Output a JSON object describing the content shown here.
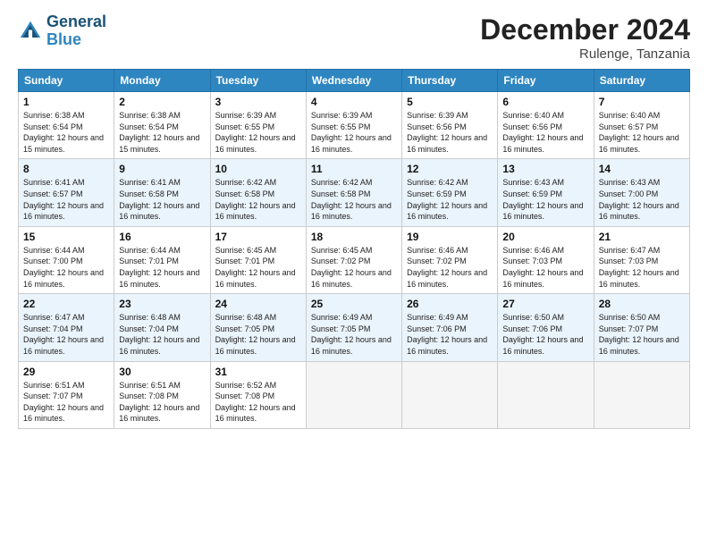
{
  "header": {
    "logo_line1": "General",
    "logo_line2": "Blue",
    "month_title": "December 2024",
    "location": "Rulenge, Tanzania"
  },
  "weekdays": [
    "Sunday",
    "Monday",
    "Tuesday",
    "Wednesday",
    "Thursday",
    "Friday",
    "Saturday"
  ],
  "days": [
    {
      "num": "",
      "sunrise": "",
      "sunset": "",
      "daylight": "",
      "empty": true
    },
    {
      "num": "",
      "sunrise": "",
      "sunset": "",
      "daylight": "",
      "empty": true
    },
    {
      "num": "",
      "sunrise": "",
      "sunset": "",
      "daylight": "",
      "empty": true
    },
    {
      "num": "",
      "sunrise": "",
      "sunset": "",
      "daylight": "",
      "empty": true
    },
    {
      "num": "",
      "sunrise": "",
      "sunset": "",
      "daylight": "",
      "empty": true
    },
    {
      "num": "",
      "sunrise": "",
      "sunset": "",
      "daylight": "",
      "empty": true
    },
    {
      "num": "1",
      "sunrise": "Sunrise: 6:38 AM",
      "sunset": "Sunset: 6:54 PM",
      "daylight": "Daylight: 12 hours and 15 minutes."
    },
    {
      "num": "2",
      "sunrise": "Sunrise: 6:38 AM",
      "sunset": "Sunset: 6:54 PM",
      "daylight": "Daylight: 12 hours and 15 minutes."
    },
    {
      "num": "3",
      "sunrise": "Sunrise: 6:39 AM",
      "sunset": "Sunset: 6:55 PM",
      "daylight": "Daylight: 12 hours and 16 minutes."
    },
    {
      "num": "4",
      "sunrise": "Sunrise: 6:39 AM",
      "sunset": "Sunset: 6:55 PM",
      "daylight": "Daylight: 12 hours and 16 minutes."
    },
    {
      "num": "5",
      "sunrise": "Sunrise: 6:39 AM",
      "sunset": "Sunset: 6:56 PM",
      "daylight": "Daylight: 12 hours and 16 minutes."
    },
    {
      "num": "6",
      "sunrise": "Sunrise: 6:40 AM",
      "sunset": "Sunset: 6:56 PM",
      "daylight": "Daylight: 12 hours and 16 minutes."
    },
    {
      "num": "7",
      "sunrise": "Sunrise: 6:40 AM",
      "sunset": "Sunset: 6:57 PM",
      "daylight": "Daylight: 12 hours and 16 minutes."
    },
    {
      "num": "8",
      "sunrise": "Sunrise: 6:41 AM",
      "sunset": "Sunset: 6:57 PM",
      "daylight": "Daylight: 12 hours and 16 minutes."
    },
    {
      "num": "9",
      "sunrise": "Sunrise: 6:41 AM",
      "sunset": "Sunset: 6:58 PM",
      "daylight": "Daylight: 12 hours and 16 minutes."
    },
    {
      "num": "10",
      "sunrise": "Sunrise: 6:42 AM",
      "sunset": "Sunset: 6:58 PM",
      "daylight": "Daylight: 12 hours and 16 minutes."
    },
    {
      "num": "11",
      "sunrise": "Sunrise: 6:42 AM",
      "sunset": "Sunset: 6:58 PM",
      "daylight": "Daylight: 12 hours and 16 minutes."
    },
    {
      "num": "12",
      "sunrise": "Sunrise: 6:42 AM",
      "sunset": "Sunset: 6:59 PM",
      "daylight": "Daylight: 12 hours and 16 minutes."
    },
    {
      "num": "13",
      "sunrise": "Sunrise: 6:43 AM",
      "sunset": "Sunset: 6:59 PM",
      "daylight": "Daylight: 12 hours and 16 minutes."
    },
    {
      "num": "14",
      "sunrise": "Sunrise: 6:43 AM",
      "sunset": "Sunset: 7:00 PM",
      "daylight": "Daylight: 12 hours and 16 minutes."
    },
    {
      "num": "15",
      "sunrise": "Sunrise: 6:44 AM",
      "sunset": "Sunset: 7:00 PM",
      "daylight": "Daylight: 12 hours and 16 minutes."
    },
    {
      "num": "16",
      "sunrise": "Sunrise: 6:44 AM",
      "sunset": "Sunset: 7:01 PM",
      "daylight": "Daylight: 12 hours and 16 minutes."
    },
    {
      "num": "17",
      "sunrise": "Sunrise: 6:45 AM",
      "sunset": "Sunset: 7:01 PM",
      "daylight": "Daylight: 12 hours and 16 minutes."
    },
    {
      "num": "18",
      "sunrise": "Sunrise: 6:45 AM",
      "sunset": "Sunset: 7:02 PM",
      "daylight": "Daylight: 12 hours and 16 minutes."
    },
    {
      "num": "19",
      "sunrise": "Sunrise: 6:46 AM",
      "sunset": "Sunset: 7:02 PM",
      "daylight": "Daylight: 12 hours and 16 minutes."
    },
    {
      "num": "20",
      "sunrise": "Sunrise: 6:46 AM",
      "sunset": "Sunset: 7:03 PM",
      "daylight": "Daylight: 12 hours and 16 minutes."
    },
    {
      "num": "21",
      "sunrise": "Sunrise: 6:47 AM",
      "sunset": "Sunset: 7:03 PM",
      "daylight": "Daylight: 12 hours and 16 minutes."
    },
    {
      "num": "22",
      "sunrise": "Sunrise: 6:47 AM",
      "sunset": "Sunset: 7:04 PM",
      "daylight": "Daylight: 12 hours and 16 minutes."
    },
    {
      "num": "23",
      "sunrise": "Sunrise: 6:48 AM",
      "sunset": "Sunset: 7:04 PM",
      "daylight": "Daylight: 12 hours and 16 minutes."
    },
    {
      "num": "24",
      "sunrise": "Sunrise: 6:48 AM",
      "sunset": "Sunset: 7:05 PM",
      "daylight": "Daylight: 12 hours and 16 minutes."
    },
    {
      "num": "25",
      "sunrise": "Sunrise: 6:49 AM",
      "sunset": "Sunset: 7:05 PM",
      "daylight": "Daylight: 12 hours and 16 minutes."
    },
    {
      "num": "26",
      "sunrise": "Sunrise: 6:49 AM",
      "sunset": "Sunset: 7:06 PM",
      "daylight": "Daylight: 12 hours and 16 minutes."
    },
    {
      "num": "27",
      "sunrise": "Sunrise: 6:50 AM",
      "sunset": "Sunset: 7:06 PM",
      "daylight": "Daylight: 12 hours and 16 minutes."
    },
    {
      "num": "28",
      "sunrise": "Sunrise: 6:50 AM",
      "sunset": "Sunset: 7:07 PM",
      "daylight": "Daylight: 12 hours and 16 minutes."
    },
    {
      "num": "29",
      "sunrise": "Sunrise: 6:51 AM",
      "sunset": "Sunset: 7:07 PM",
      "daylight": "Daylight: 12 hours and 16 minutes."
    },
    {
      "num": "30",
      "sunrise": "Sunrise: 6:51 AM",
      "sunset": "Sunset: 7:08 PM",
      "daylight": "Daylight: 12 hours and 16 minutes."
    },
    {
      "num": "31",
      "sunrise": "Sunrise: 6:52 AM",
      "sunset": "Sunset: 7:08 PM",
      "daylight": "Daylight: 12 hours and 16 minutes."
    },
    {
      "num": "",
      "sunrise": "",
      "sunset": "",
      "daylight": "",
      "empty": true
    },
    {
      "num": "",
      "sunrise": "",
      "sunset": "",
      "daylight": "",
      "empty": true
    },
    {
      "num": "",
      "sunrise": "",
      "sunset": "",
      "daylight": "",
      "empty": true
    },
    {
      "num": "",
      "sunrise": "",
      "sunset": "",
      "daylight": "",
      "empty": true
    },
    {
      "num": "",
      "sunrise": "",
      "sunset": "",
      "daylight": "",
      "empty": true
    }
  ]
}
